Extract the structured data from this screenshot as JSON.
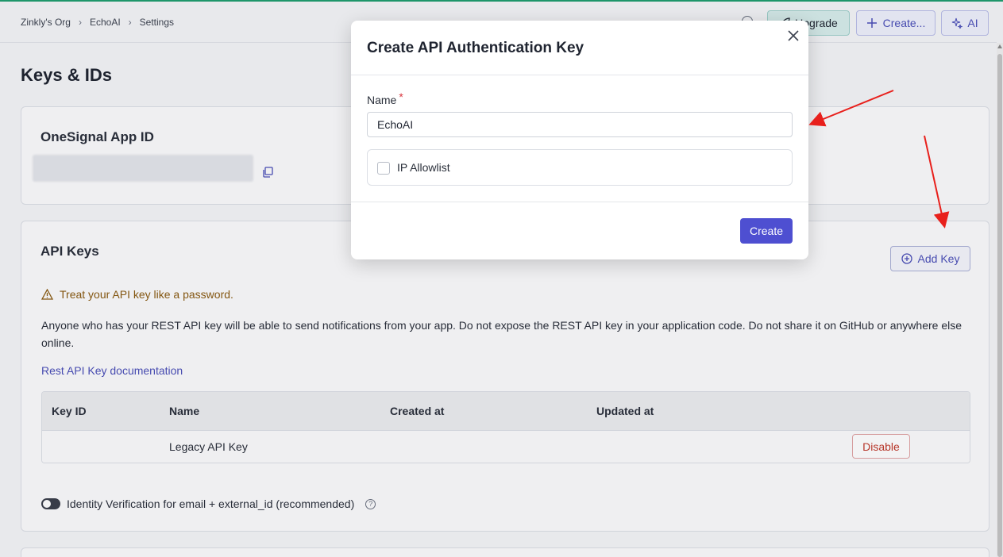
{
  "breadcrumb": {
    "org": "Zinkly's Org",
    "app": "EchoAI",
    "page": "Settings",
    "separator": "›"
  },
  "header": {
    "upgrade_label": "Upgrade",
    "create_label": "Create...",
    "ai_label": "AI"
  },
  "page_title": "Keys & IDs",
  "app_id_card": {
    "title": "OneSignal App ID"
  },
  "api_keys_card": {
    "title": "API Keys",
    "add_key_label": "Add Key",
    "warning": "Treat your API key like a password.",
    "description": "Anyone who has your REST API key will be able to send notifications from your app. Do not expose the REST API key in your application code. Do not share it on GitHub or anywhere else online.",
    "doc_link": "Rest API Key documentation",
    "table": {
      "columns": [
        "Key ID",
        "Name",
        "Created at",
        "Updated at"
      ],
      "rows": [
        {
          "key_id": "",
          "name": "Legacy API Key",
          "created_at": "",
          "updated_at": "",
          "action": "Disable"
        }
      ]
    },
    "identity_verification": "Identity Verification for email + external_id (recommended)",
    "help_glyph": "?"
  },
  "modal": {
    "title": "Create API Authentication Key",
    "name_label": "Name",
    "required_mark": "*",
    "name_value": "EchoAI",
    "ip_allowlist_label": "IP Allowlist",
    "create_label": "Create"
  },
  "colors": {
    "primary": "#4e4fd1",
    "accent_link": "#4a4fb8",
    "warning": "#8a5a10",
    "danger": "#c0392b",
    "annotation_arrow": "#e8201c"
  }
}
